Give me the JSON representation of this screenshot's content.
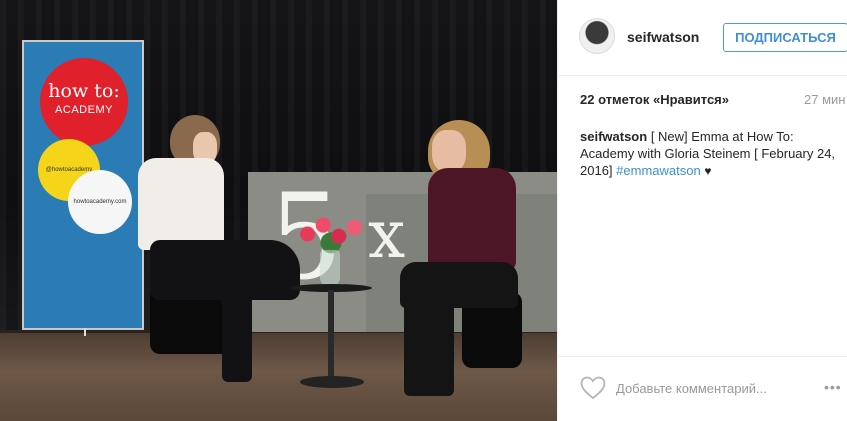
{
  "post": {
    "photo_banner": {
      "brand_line1": "how to:",
      "brand_line2": "ACADEMY",
      "handle": "@howtoacademy",
      "site": "howtoacademy.com"
    },
    "backdrop_text": {
      "digit": "5",
      "letter": "x"
    }
  },
  "header": {
    "username": "seifwatson",
    "follow_label": "ПОДПИСАТЬСЯ"
  },
  "stats": {
    "likes": "22 отметок «Нравится»",
    "time": "27 мин"
  },
  "caption": {
    "username": "seifwatson",
    "text": "[ New] Emma at How To: Academy with Gloria Steinem [ February 24, 2016]",
    "hashtag": "#emmawatson",
    "emoji": "♥"
  },
  "footer": {
    "comment_placeholder": "Добавьте комментарий...",
    "more_glyph": "•••"
  }
}
